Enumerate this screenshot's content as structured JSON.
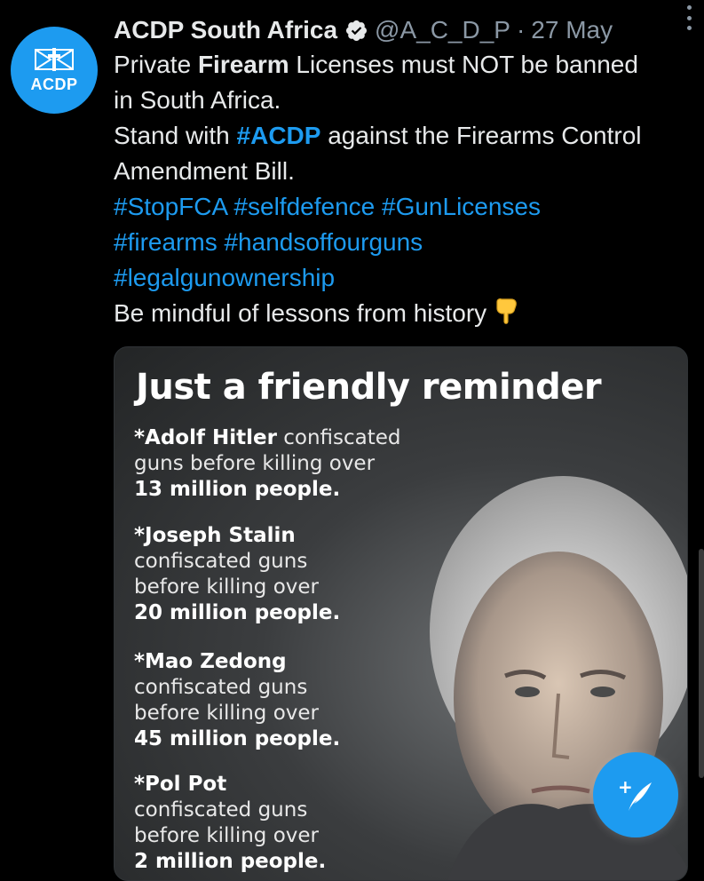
{
  "account": {
    "name": "ACDP South Africa",
    "handle": "@A_C_D_P",
    "separator": "·",
    "date": "27 May",
    "avatar_text": "ACDP",
    "verified": true
  },
  "tweet": {
    "l1a": "Private ",
    "l1b": "Firearm",
    "l1c": " Licenses must NOT be banned",
    "l2": "in South Africa.",
    "l3a": "Stand with ",
    "l3b": "#ACDP",
    "l3c": " against the Firearms Control",
    "l4": "Amendment Bill.",
    "l5": [
      "#StopFCA",
      "#selfdefence",
      "#GunLicenses"
    ],
    "l6": [
      "#firearms",
      "#handsoffourguns"
    ],
    "l7": "#legalgunownership",
    "l8": "Be mindful of lessons from history",
    "emoji": "backhand-index-pointing-down"
  },
  "image": {
    "title": "Just a friendly reminder",
    "facts": [
      {
        "who": "*Adolf Hitler",
        "rest1": " confiscated",
        "rest2": "guns before killing over",
        "num": "13 million people."
      },
      {
        "who": "*Joseph Stalin",
        "rest1": "confiscated guns",
        "rest2": "before killing over",
        "num": "20 million people."
      },
      {
        "who": "*Mao Zedong",
        "rest1": "confiscated guns",
        "rest2": "before killing over",
        "num": "45 million people."
      },
      {
        "who": "*Pol Pot",
        "rest1": "confiscated guns",
        "rest2": "before killing over",
        "num": "2 million people."
      }
    ]
  },
  "compose_button": {
    "icon": "compose-tweet-icon",
    "plus": "+"
  },
  "colors": {
    "accent": "#1d9bf0",
    "background": "#000000",
    "text": "#e7e9ea",
    "muted": "#8b98a5"
  }
}
